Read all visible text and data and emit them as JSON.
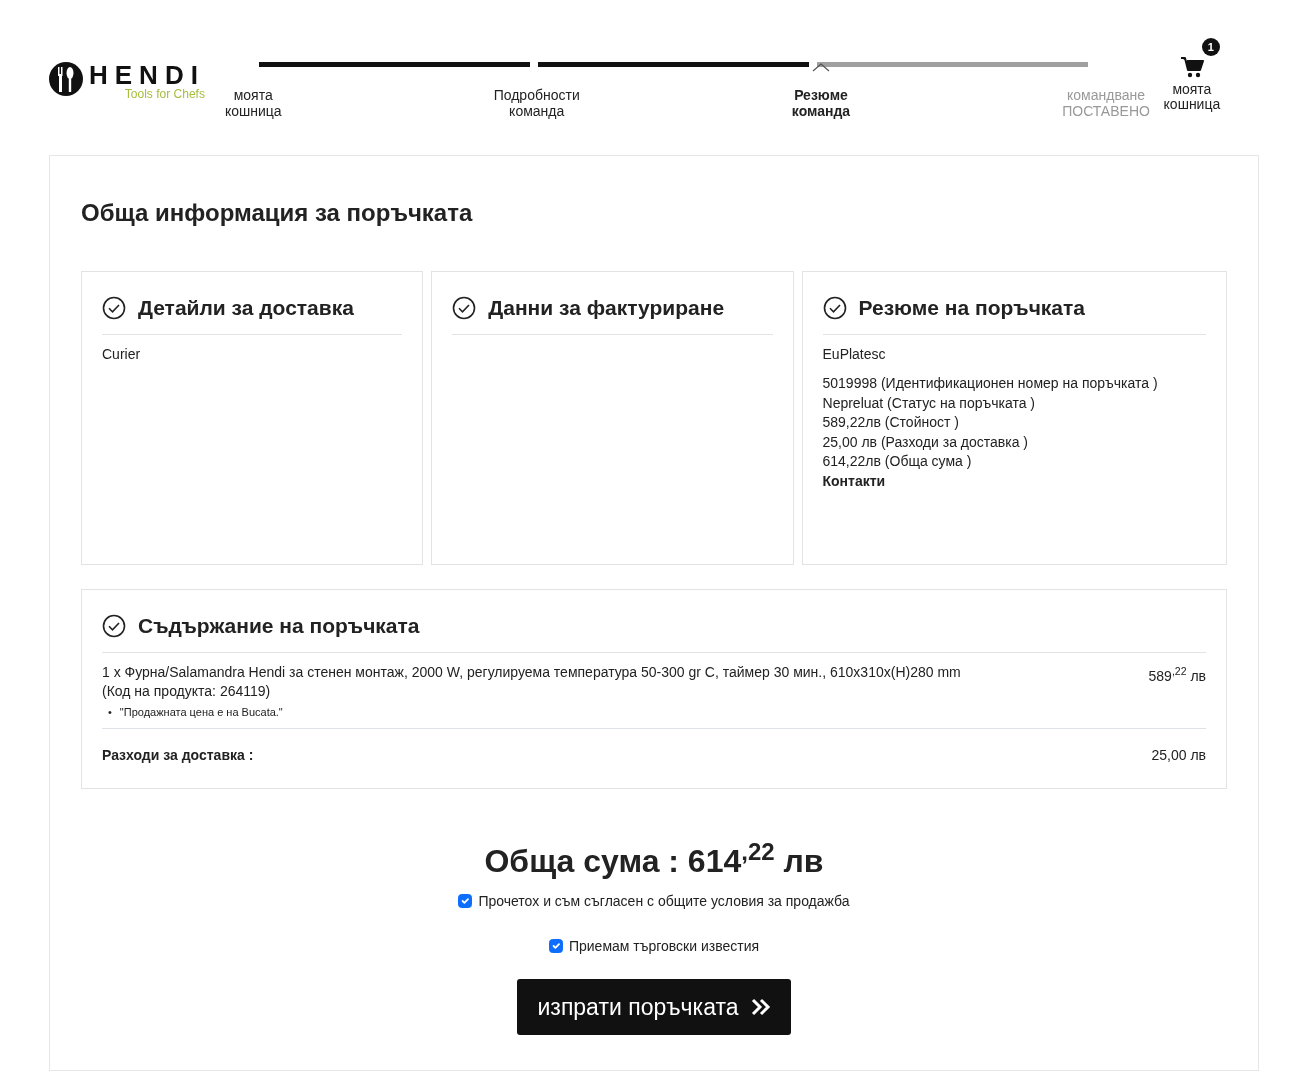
{
  "header": {
    "logo": {
      "brand": "HENDI",
      "tagline": "Tools for Chefs"
    },
    "steps": [
      {
        "label": [
          "моята",
          "кошница"
        ],
        "done": true,
        "current": false
      },
      {
        "label": [
          "Подробности",
          "команда"
        ],
        "done": true,
        "current": false
      },
      {
        "label": [
          "Резюме",
          "команда"
        ],
        "done": true,
        "current": true
      },
      {
        "label": [
          "командване",
          "ПОСТАВЕНО"
        ],
        "done": false,
        "current": false
      }
    ],
    "cart": {
      "count": "1",
      "label": [
        "моята",
        "кошница"
      ]
    }
  },
  "title": "Обща информация за поръчката",
  "panels": [
    {
      "heading": "Детайли за доставка",
      "lines": [
        {
          "kind": "method",
          "text": "Curier"
        }
      ]
    },
    {
      "heading": "Данни за фактуриране"
    },
    {
      "heading": "Резюме на поръчката",
      "lines": [
        {
          "kind": "method",
          "text": "EuPlatesc"
        },
        {
          "kind": "detail",
          "text": "5019998 (Идентификационен номер на поръчката )"
        },
        {
          "kind": "detail",
          "text": "Nepreluat (Статус на поръчката )"
        },
        {
          "kind": "detail",
          "text": "589,22лв (Стойност )"
        },
        {
          "kind": "detail",
          "text": "25,00 лв (Разходи за доставка )"
        },
        {
          "kind": "detail",
          "text": "614,22лв (Обща сума )"
        },
        {
          "kind": "bold",
          "text": "Контакти"
        }
      ]
    }
  ],
  "contents": {
    "heading": "Съдържание на поръчката",
    "items": [
      {
        "name": "1 x  Фурна/Salamandra Hendi за стенен монтаж, 2000 W, регулируема температура 50-300 gr C, таймер 30 мин., 610x310x(H)280 mm",
        "code": "(Код на продукта: 264119)",
        "notes": [
          {
            "bullet": "•",
            "text": "\"Продажната цена е на Bucata.\""
          }
        ],
        "price": "589$^{,22}$ лв"
      }
    ],
    "shipping": {
      "label": "Разходи за доставка :",
      "price": "25,00 лв"
    }
  },
  "total": "Обща сума : 614$^{,22}$ лв",
  "checkboxes": [
    {
      "label": "Прочетох и съм съгласен с общите условия за продажба",
      "checked": true
    },
    {
      "label": "Приемам търговски известия",
      "checked": true
    }
  ],
  "submit": {
    "label": "изпрати поръчката"
  }
}
